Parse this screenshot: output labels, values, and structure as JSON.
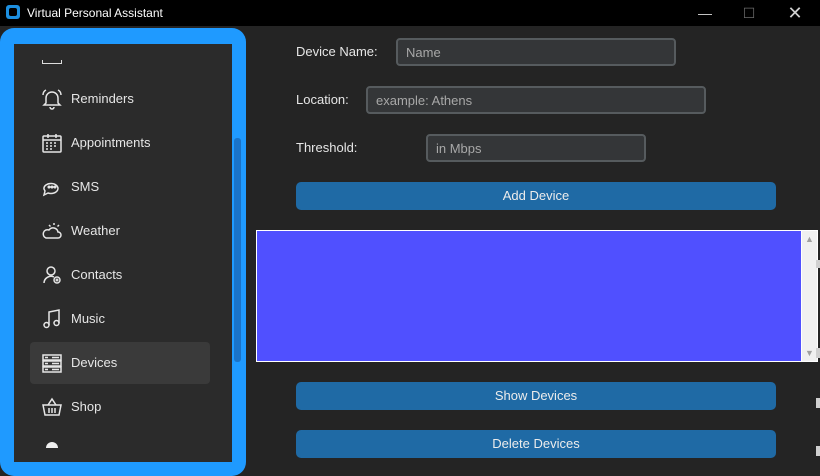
{
  "window": {
    "title": "Virtual Personal Assistant",
    "controls": {
      "minimize": "—",
      "maximize": "☐",
      "close": "✕"
    }
  },
  "sidebar": {
    "items": [
      {
        "label": "Reminders",
        "icon": "bell-icon"
      },
      {
        "label": "Appointments",
        "icon": "calendar-icon"
      },
      {
        "label": "SMS",
        "icon": "chat-icon"
      },
      {
        "label": "Weather",
        "icon": "weather-icon"
      },
      {
        "label": "Contacts",
        "icon": "contact-icon"
      },
      {
        "label": "Music",
        "icon": "music-icon"
      },
      {
        "label": "Devices",
        "icon": "devices-icon",
        "active": true
      },
      {
        "label": "Shop",
        "icon": "basket-icon"
      }
    ]
  },
  "form": {
    "device_name": {
      "label": "Device Name:",
      "placeholder": "Name"
    },
    "location": {
      "label": "Location:",
      "placeholder": "example: Athens"
    },
    "threshold": {
      "label": "Threshold:",
      "placeholder": "in Mbps"
    }
  },
  "buttons": {
    "add_device": "Add Device",
    "show_devices": "Show Devices",
    "delete_devices": "Delete Devices"
  },
  "listbox": {
    "background": "#5050ff",
    "scroll_up": "▲",
    "scroll_down": "▼"
  },
  "colors": {
    "accent": "#1f9aff",
    "button": "#1f6aa5",
    "background": "#242424",
    "sidebar": "#2b2b2b"
  }
}
